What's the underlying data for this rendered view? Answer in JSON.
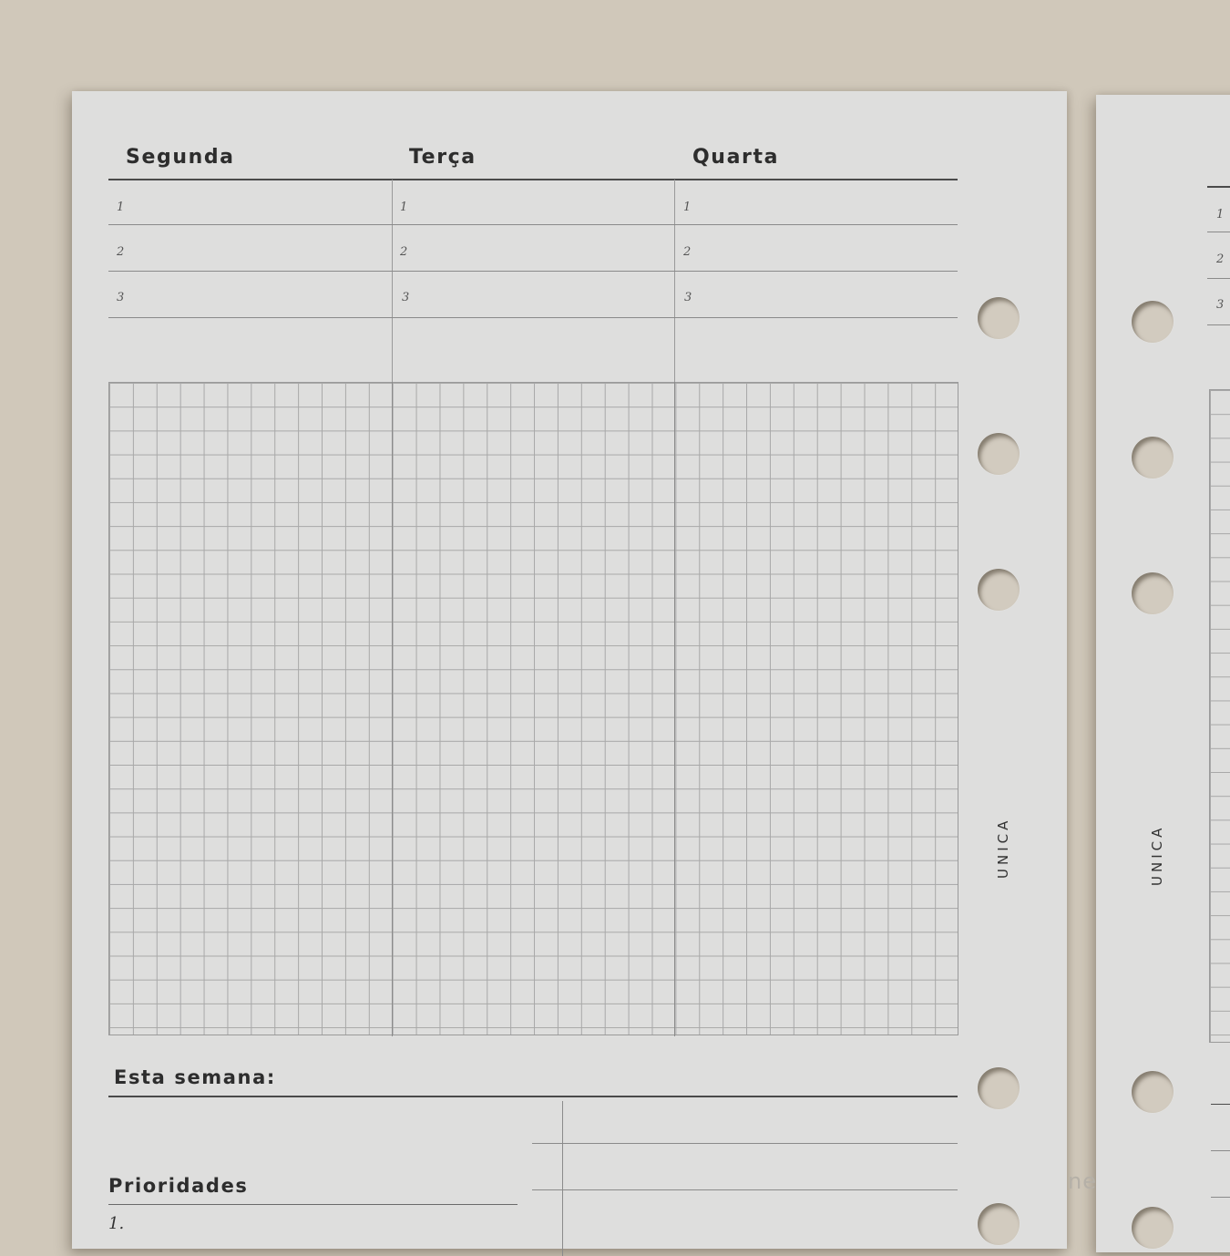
{
  "left_page": {
    "days": [
      "Segunda",
      "Terça",
      "Quarta"
    ],
    "row_numbers": [
      "1",
      "2",
      "3"
    ],
    "week_label": "Esta semana:",
    "priorities_label": "Prioridades",
    "priority_first": "1.",
    "brand": "UNICA"
  },
  "right_page": {
    "brand": "UNICA",
    "row_numbers": [
      "1",
      "2",
      "3"
    ]
  },
  "watermark": "ne",
  "colors": {
    "background": "#d0c8ba",
    "paper": "#dededd",
    "ink": "#2d2d2d",
    "grid": "#a8a8a8"
  }
}
